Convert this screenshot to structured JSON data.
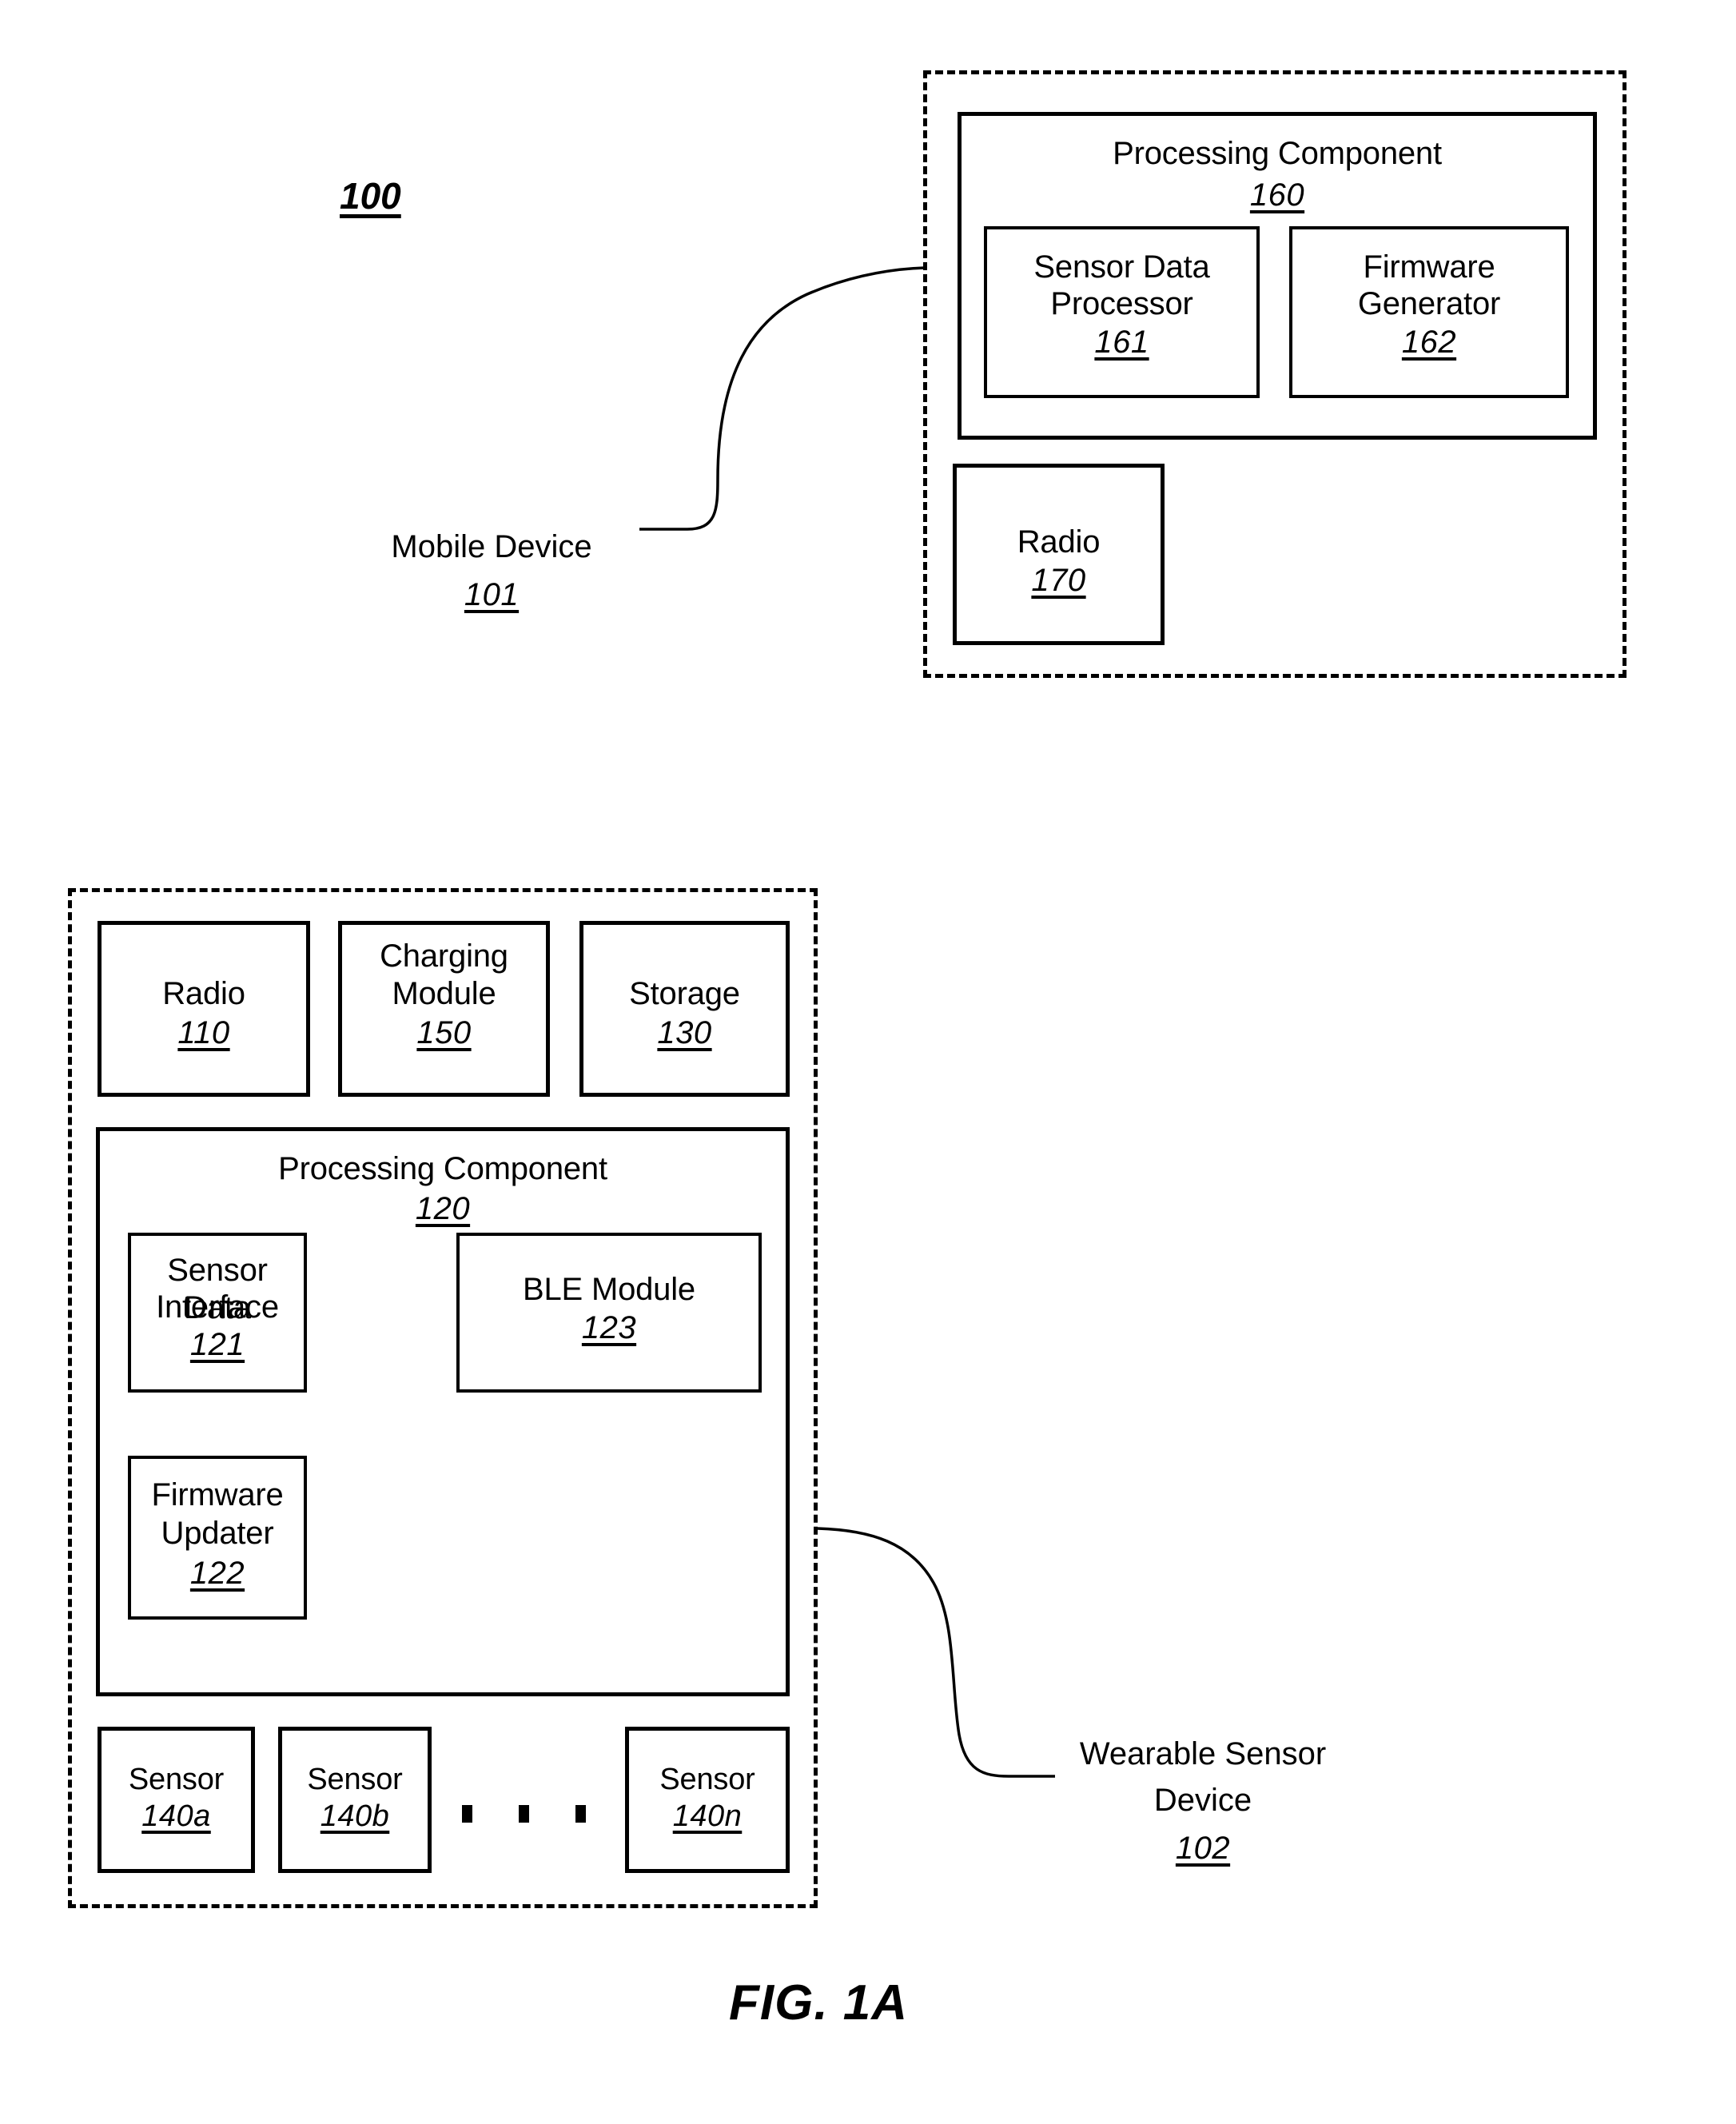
{
  "figure": {
    "caption": "FIG. 1A",
    "system_ref": "100"
  },
  "mobile_device": {
    "callout_label": "Mobile Device",
    "callout_ref": "101",
    "processing_component": {
      "title": "Processing Component",
      "ref": "160",
      "children": [
        {
          "title": "Sensor Data\nProcessor",
          "line1": "Sensor Data",
          "line2": "Processor",
          "ref": "161"
        },
        {
          "title": "Firmware\nGenerator",
          "line1": "Firmware",
          "line2": "Generator",
          "ref": "162"
        }
      ]
    },
    "radio": {
      "title": "Radio",
      "ref": "170"
    }
  },
  "wearable_sensor_device": {
    "callout_line1": "Wearable Sensor",
    "callout_line2": "Device",
    "callout_ref": "102",
    "top_row": [
      {
        "line1": "Radio",
        "line2": "",
        "ref": "110"
      },
      {
        "line1": "Charging",
        "line2": "Module",
        "ref": "150"
      },
      {
        "line1": "Storage",
        "line2": "",
        "ref": "130"
      }
    ],
    "processing_component": {
      "title": "Processing Component",
      "ref": "120",
      "children": [
        {
          "line1": "Sensor Data",
          "line2": "Interface",
          "ref": "121"
        },
        {
          "line1": "BLE Module",
          "line2": "",
          "ref": "123"
        },
        {
          "line1": "Firmware",
          "line2": "Updater",
          "ref": "122"
        }
      ]
    },
    "sensors": [
      {
        "label": "Sensor",
        "ref": "140a"
      },
      {
        "label": "Sensor",
        "ref": "140b"
      },
      {
        "label": "Sensor",
        "ref": "140n"
      }
    ],
    "ellipsis": "• • •"
  },
  "colors": {
    "stroke": "#000000",
    "background": "#ffffff"
  }
}
